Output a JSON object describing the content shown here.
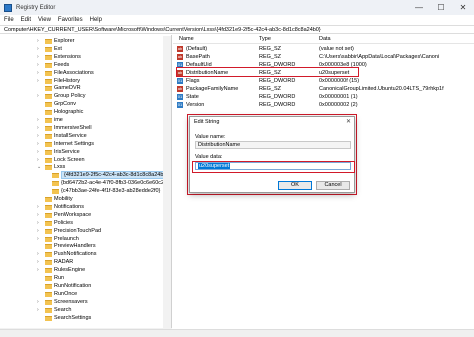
{
  "window": {
    "title": "Registry Editor",
    "minimize_glyph": "—",
    "maximize_glyph": "☐",
    "close_glyph": "✕"
  },
  "menu": [
    "File",
    "Edit",
    "View",
    "Favorites",
    "Help"
  ],
  "address": "Computer\\HKEY_CURRENT_USER\\Software\\Microsoft\\Windows\\CurrentVersion\\Lxss\\{4fd321e9-2f5c-42c4-ab3c-8d1c8c8a24b0}",
  "tree": [
    {
      "label": "Explorer",
      "chevron": "›"
    },
    {
      "label": "Ext",
      "chevron": "›"
    },
    {
      "label": "Extensions",
      "chevron": "›"
    },
    {
      "label": "Feeds",
      "chevron": "›"
    },
    {
      "label": "FileAssociations",
      "chevron": "›"
    },
    {
      "label": "FileHistory",
      "chevron": "›"
    },
    {
      "label": "GameDVR",
      "chevron": ""
    },
    {
      "label": "Group Policy",
      "chevron": "›"
    },
    {
      "label": "GrpConv",
      "chevron": ""
    },
    {
      "label": "Holographic",
      "chevron": ""
    },
    {
      "label": "ime",
      "chevron": "›"
    },
    {
      "label": "ImmersiveShell",
      "chevron": "›"
    },
    {
      "label": "InstallService",
      "chevron": "›"
    },
    {
      "label": "Internet Settings",
      "chevron": "›"
    },
    {
      "label": "IrisService",
      "chevron": "›"
    },
    {
      "label": "Lock Screen",
      "chevron": "›"
    },
    {
      "label": "Lxss",
      "chevron": "⌄"
    },
    {
      "label": "{4fd321e9-2f5c-42c4-ab3c-8d1c8c8a24b0}",
      "chevron": "",
      "child": true,
      "selected": true
    },
    {
      "label": "{bd6472b2-ac4e-47f0-8fb3-036e0c6e60c2}",
      "chevron": "",
      "child": true
    },
    {
      "label": "{c47bb3ae-24fe-4f1f-83e3-ab28edde2f0}",
      "chevron": "",
      "child": true
    },
    {
      "label": "Mobility",
      "chevron": ""
    },
    {
      "label": "Notifications",
      "chevron": "›"
    },
    {
      "label": "PenWorkspace",
      "chevron": "›"
    },
    {
      "label": "Policies",
      "chevron": "›"
    },
    {
      "label": "PrecisionTouchPad",
      "chevron": "›"
    },
    {
      "label": "Prelaunch",
      "chevron": "›"
    },
    {
      "label": "PreviewHandlers",
      "chevron": ""
    },
    {
      "label": "PushNotifications",
      "chevron": "›"
    },
    {
      "label": "RADAR",
      "chevron": "›"
    },
    {
      "label": "RulesEngine",
      "chevron": "›"
    },
    {
      "label": "Run",
      "chevron": ""
    },
    {
      "label": "RunNotification",
      "chevron": ""
    },
    {
      "label": "RunOnce",
      "chevron": ""
    },
    {
      "label": "Screensavers",
      "chevron": "›"
    },
    {
      "label": "Search",
      "chevron": "›"
    },
    {
      "label": "SearchSettings",
      "chevron": ""
    }
  ],
  "values_header": {
    "name": "Name",
    "type": "Type",
    "data": "Data"
  },
  "values": [
    {
      "name": "(Default)",
      "type": "REG_SZ",
      "data": "(value not set)",
      "icon": "ab"
    },
    {
      "name": "BasePath",
      "type": "REG_SZ",
      "data": "C:\\Users\\sabbir\\AppData\\Local\\Packages\\Canoni",
      "icon": "ab"
    },
    {
      "name": "DefaultUid",
      "type": "REG_DWORD",
      "data": "0x000003e8 (1000)",
      "icon": "bin"
    },
    {
      "name": "DistributionName",
      "type": "REG_SZ",
      "data": "u20superset",
      "icon": "ab"
    },
    {
      "name": "Flags",
      "type": "REG_DWORD",
      "data": "0x0000000f (15)",
      "icon": "bin"
    },
    {
      "name": "PackageFamilyName",
      "type": "REG_SZ",
      "data": "CanonicalGroupLimited.Ubuntu20.04LTS_79rhkp1f",
      "icon": "ab"
    },
    {
      "name": "State",
      "type": "REG_DWORD",
      "data": "0x00000001 (1)",
      "icon": "bin"
    },
    {
      "name": "Version",
      "type": "REG_DWORD",
      "data": "0x00000002 (2)",
      "icon": "bin"
    }
  ],
  "dialog": {
    "title": "Edit String",
    "close_glyph": "✕",
    "value_name_label": "Value name:",
    "value_name": "DistributionName",
    "value_data_label": "Value data:",
    "value_data": "u20superset",
    "ok": "OK",
    "cancel": "Cancel"
  },
  "colors": {
    "accent": "#0078d7",
    "annotation": "#d11a2a",
    "folder": "#f3c350"
  }
}
